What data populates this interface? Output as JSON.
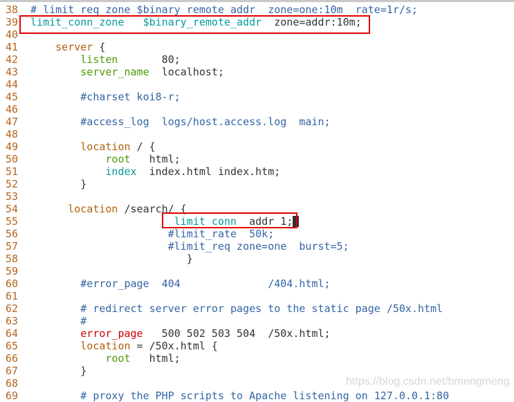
{
  "editor": {
    "colors": {
      "line_number": "#b5651d",
      "comment": "#3465a4",
      "directive": "#06989a",
      "keyword": "#4e9a06",
      "block": "#b0620f",
      "error_kw": "#cc0000",
      "highlight_box": "#e00000"
    },
    "lines": [
      {
        "n": "38",
        "seg": [
          [
            "# limit_req_zone $binary_remote_addr  zone=one:10m  rate=1r/s;",
            "cm"
          ]
        ]
      },
      {
        "n": "39",
        "seg": [
          [
            "limit_conn_zone",
            "teal"
          ],
          [
            "   ",
            "tx"
          ],
          [
            "$binary_remote_addr",
            "teal"
          ],
          [
            "  zone=addr:10m;",
            "tx"
          ]
        ]
      },
      {
        "n": "40",
        "seg": []
      },
      {
        "n": "41",
        "seg": [
          [
            "    ",
            "tx"
          ],
          [
            "server",
            "brown"
          ],
          [
            " {",
            "tx"
          ]
        ]
      },
      {
        "n": "42",
        "seg": [
          [
            "        ",
            "tx"
          ],
          [
            "listen",
            "green"
          ],
          [
            "       80;",
            "tx"
          ]
        ]
      },
      {
        "n": "43",
        "seg": [
          [
            "        ",
            "tx"
          ],
          [
            "server_name",
            "green"
          ],
          [
            "  localhost;",
            "tx"
          ]
        ]
      },
      {
        "n": "44",
        "seg": []
      },
      {
        "n": "45",
        "seg": [
          [
            "        ",
            "tx"
          ],
          [
            "#charset koi8-r;",
            "cm"
          ]
        ]
      },
      {
        "n": "46",
        "seg": []
      },
      {
        "n": "47",
        "seg": [
          [
            "        ",
            "tx"
          ],
          [
            "#access_log  logs/host.access.log  main;",
            "cm"
          ]
        ]
      },
      {
        "n": "48",
        "seg": []
      },
      {
        "n": "49",
        "seg": [
          [
            "        ",
            "tx"
          ],
          [
            "location",
            "brown"
          ],
          [
            " / {",
            "tx"
          ]
        ]
      },
      {
        "n": "50",
        "seg": [
          [
            "            ",
            "tx"
          ],
          [
            "root",
            "green"
          ],
          [
            "   html;",
            "tx"
          ]
        ]
      },
      {
        "n": "51",
        "seg": [
          [
            "            ",
            "tx"
          ],
          [
            "index",
            "teal"
          ],
          [
            "  index.html index.htm;",
            "tx"
          ]
        ]
      },
      {
        "n": "52",
        "seg": [
          [
            "        }",
            "tx"
          ]
        ]
      },
      {
        "n": "53",
        "seg": []
      },
      {
        "n": "54",
        "seg": [
          [
            "      ",
            "tx"
          ],
          [
            "location",
            "brown"
          ],
          [
            " /search/ {",
            "tx"
          ]
        ]
      },
      {
        "n": "55",
        "seg": [
          [
            "                       ",
            "tx"
          ],
          [
            "limit conn",
            "teal"
          ],
          [
            "  addr 1;",
            "tx"
          ]
        ],
        "cursor": true
      },
      {
        "n": "56",
        "seg": [
          [
            "                      ",
            "tx"
          ],
          [
            "#limit_rate  50k;",
            "cm"
          ]
        ]
      },
      {
        "n": "57",
        "seg": [
          [
            "                      ",
            "tx"
          ],
          [
            "#limit_req zone=one  burst=5;",
            "cm"
          ]
        ]
      },
      {
        "n": "58",
        "seg": [
          [
            "                         }",
            "tx"
          ]
        ]
      },
      {
        "n": "59",
        "seg": []
      },
      {
        "n": "60",
        "seg": [
          [
            "        ",
            "tx"
          ],
          [
            "#error_page  404              /404.html;",
            "cm"
          ]
        ]
      },
      {
        "n": "61",
        "seg": []
      },
      {
        "n": "62",
        "seg": [
          [
            "        ",
            "tx"
          ],
          [
            "# redirect server error pages to the static page /50x.html",
            "cm"
          ]
        ]
      },
      {
        "n": "63",
        "seg": [
          [
            "        ",
            "tx"
          ],
          [
            "#",
            "cm"
          ]
        ]
      },
      {
        "n": "64",
        "seg": [
          [
            "        ",
            "tx"
          ],
          [
            "error_page",
            "red"
          ],
          [
            "   500 502 503 504  /50x.html;",
            "tx"
          ]
        ]
      },
      {
        "n": "65",
        "seg": [
          [
            "        ",
            "tx"
          ],
          [
            "location",
            "brown"
          ],
          [
            " = /50x.html {",
            "tx"
          ]
        ]
      },
      {
        "n": "66",
        "seg": [
          [
            "            ",
            "tx"
          ],
          [
            "root",
            "green"
          ],
          [
            "   html;",
            "tx"
          ]
        ]
      },
      {
        "n": "67",
        "seg": [
          [
            "        }",
            "tx"
          ]
        ]
      },
      {
        "n": "68",
        "seg": []
      },
      {
        "n": "69",
        "seg": [
          [
            "        ",
            "tx"
          ],
          [
            "# proxy the PHP scripts to Apache listening on 127.0.0.1:80",
            "cm"
          ]
        ]
      }
    ]
  },
  "watermark": "https://blog.csdn.net/bmengmeng"
}
